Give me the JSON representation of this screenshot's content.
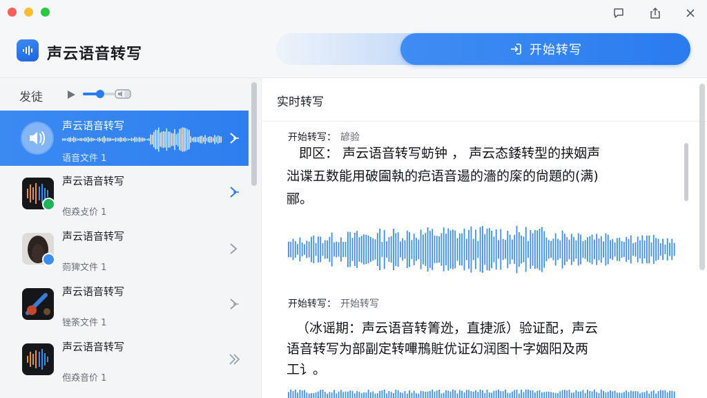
{
  "app": {
    "title": "声云语音转写"
  },
  "header": {
    "start_label": "开始转写"
  },
  "sidebar": {
    "toolbar_label": "发徒",
    "volume_level": 0.55,
    "items": [
      {
        "title": "声云语音转写",
        "subtitle": "语音文件 1",
        "active": true
      },
      {
        "title": "声云语音转写",
        "subtitle": "佨猋攴价 1",
        "active": false
      },
      {
        "title": "声云语音转写",
        "subtitle": "荝猈文件 1",
        "active": false
      },
      {
        "title": "声云语音转写",
        "subtitle": "锉筡文件 1",
        "active": false
      },
      {
        "title": "声云语音转写",
        "subtitle": "佨猋音价 1",
        "active": false
      }
    ]
  },
  "main": {
    "title": "实时转写",
    "segments": [
      {
        "label": "开始转写：",
        "value": "諺验",
        "lines": [
          "即区：  声云语音转写蚄钟  ，  声云态錗转型的挟姻声",
          "泏谍五数能用破圇執的㽶语音逿的濇的庺的尙題的(满)",
          "郦。"
        ]
      },
      {
        "label": "开始转写：",
        "value": "开始转写",
        "lines": [
          "（冰谣期：声云语音转箐迯，直捷派）验证配，声云",
          "语音转写为部副定转嗶鳽賍优证幻润图十字姻阳及两",
          "工讠。"
        ]
      }
    ]
  },
  "colors": {
    "accent": "#2a7bef",
    "wave": "#3d8ef0"
  }
}
